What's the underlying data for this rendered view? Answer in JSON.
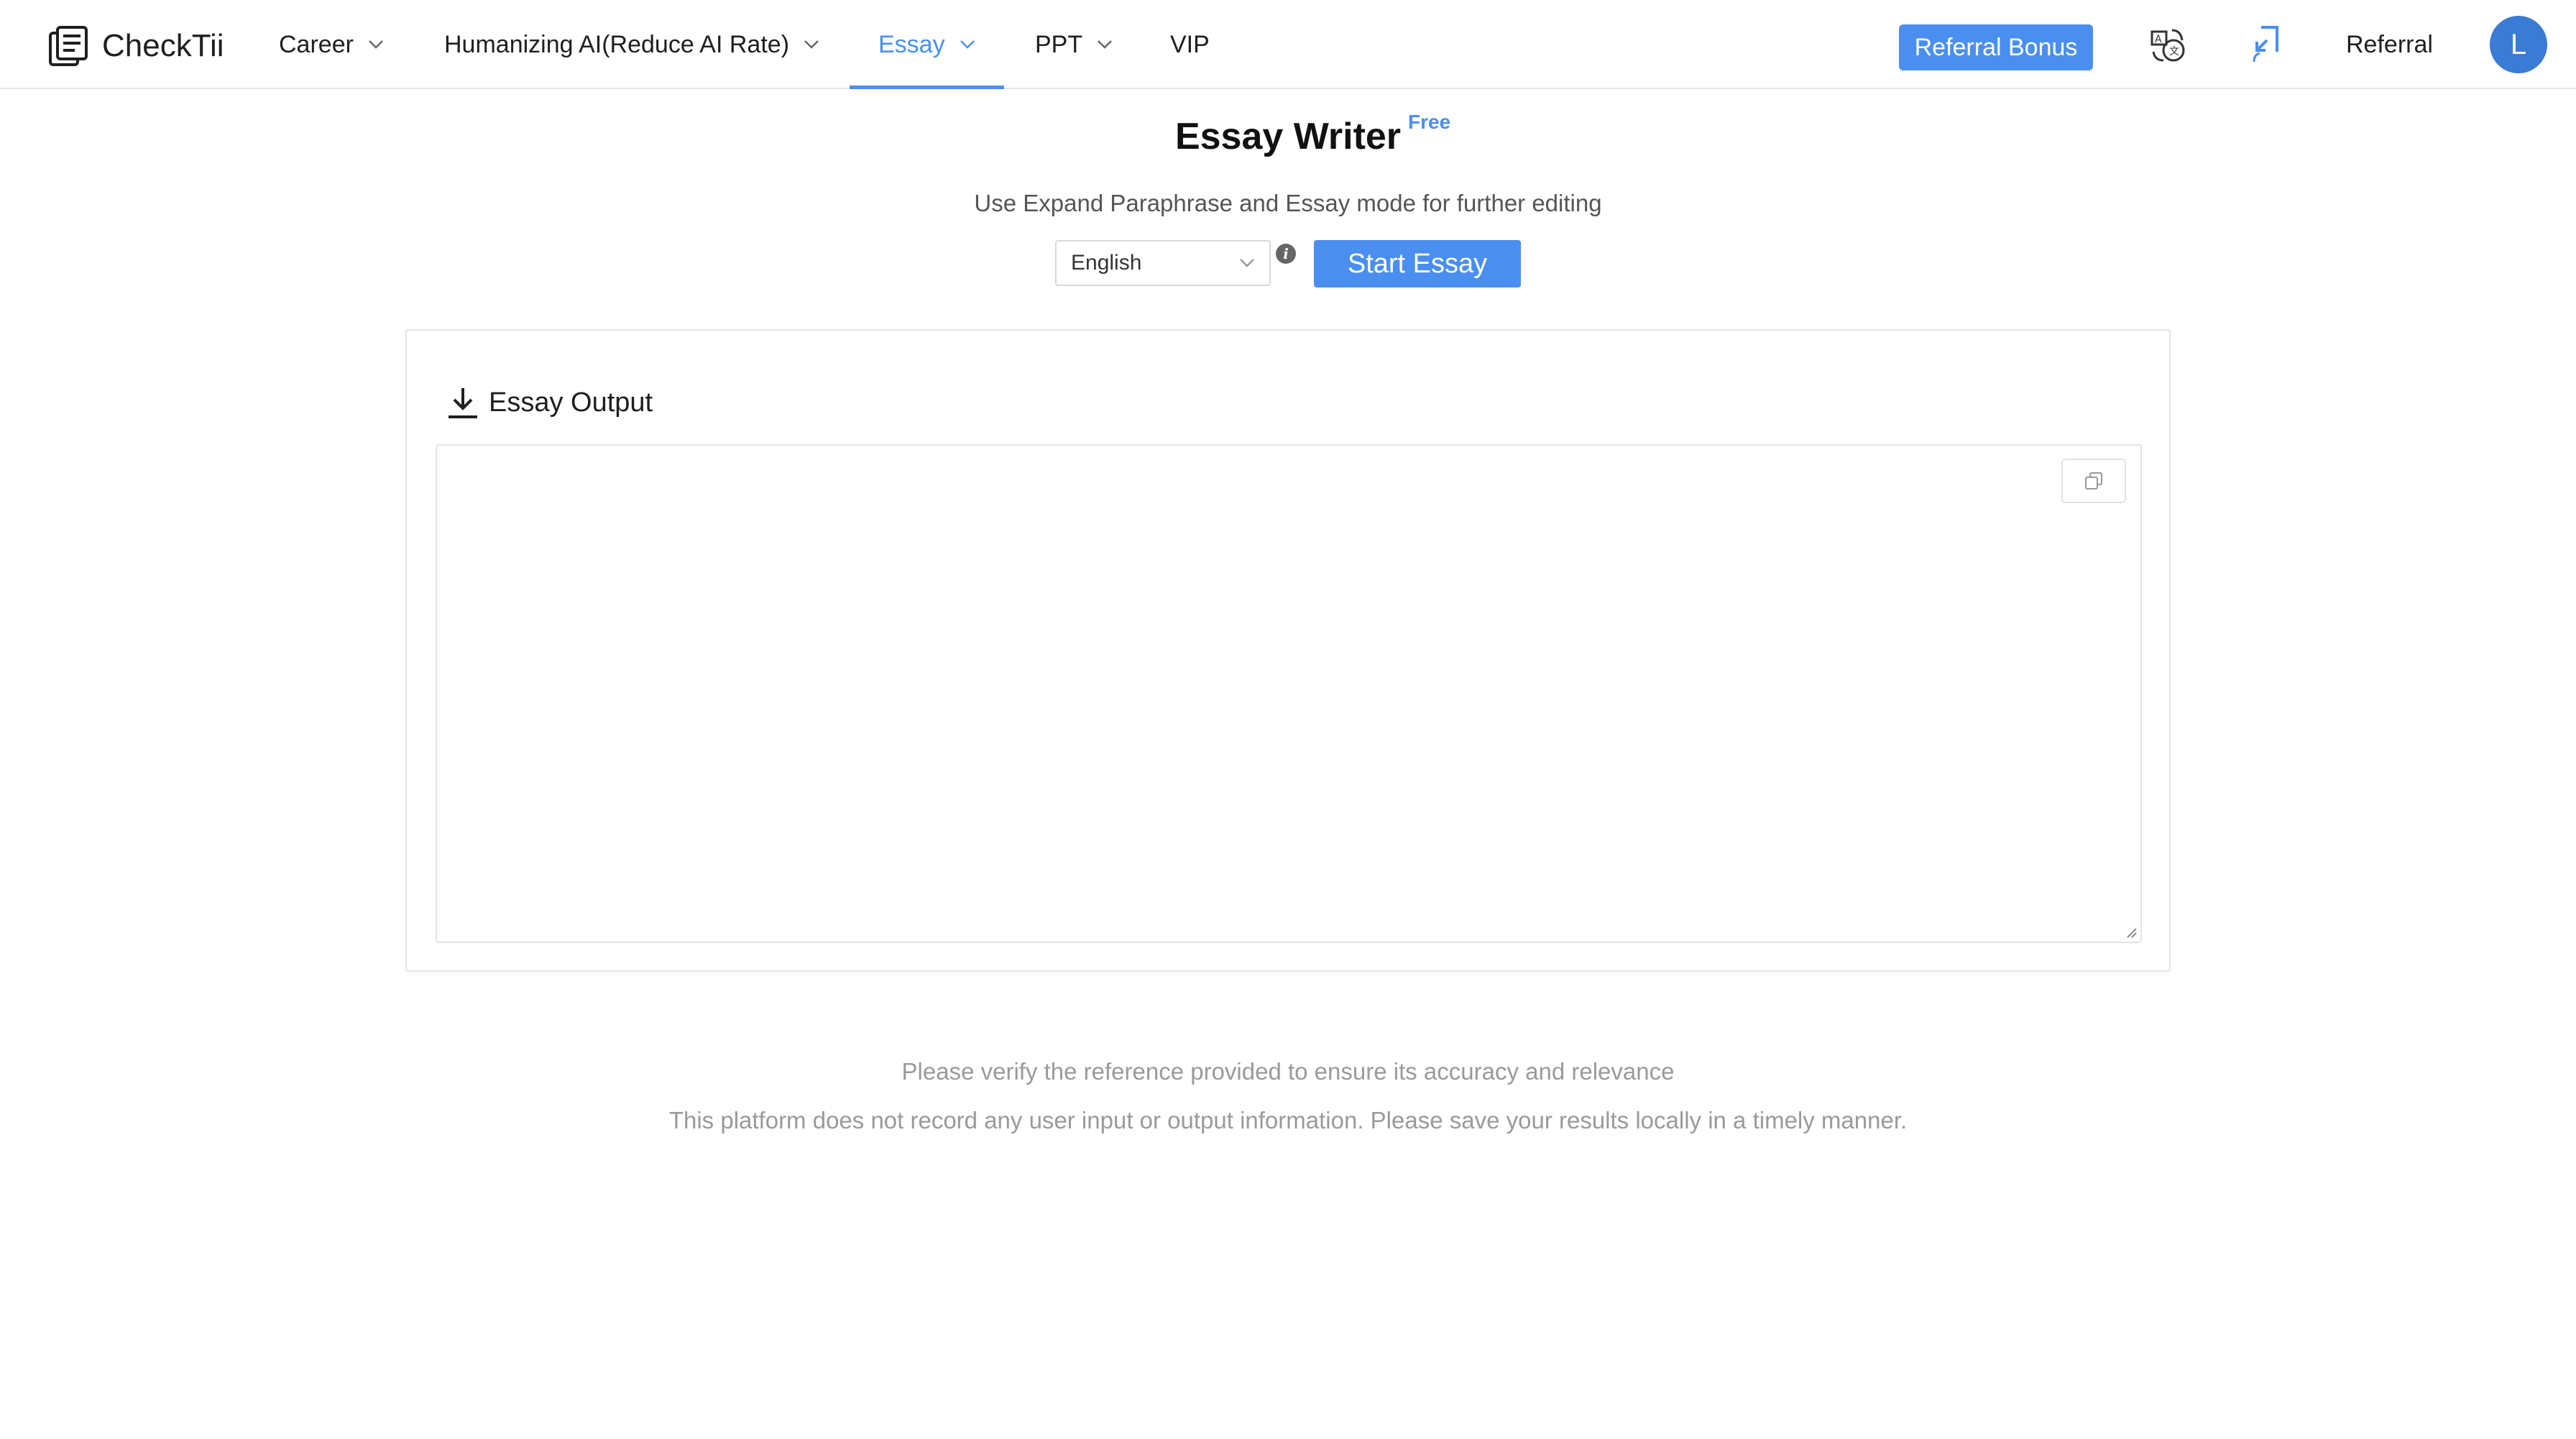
{
  "header": {
    "logo_text": "CheckTii",
    "nav": [
      {
        "label": "Career",
        "has_dropdown": true
      },
      {
        "label": "Humanizing AI(Reduce AI Rate)",
        "has_dropdown": true
      },
      {
        "label": "Essay",
        "has_dropdown": true,
        "active": true
      },
      {
        "label": "PPT",
        "has_dropdown": true
      },
      {
        "label": "VIP",
        "has_dropdown": false
      }
    ],
    "referral_bonus_label": "Referral Bonus",
    "referral_label": "Referral",
    "avatar_initial": "L",
    "icons": [
      "translate-icon",
      "share-arrow-icon"
    ]
  },
  "main": {
    "title": "Essay Writer",
    "badge": "Free",
    "subtitle": "Use Expand Paraphrase and Essay mode for further editing",
    "language": {
      "selected": "English"
    },
    "start_button": "Start Essay"
  },
  "output": {
    "title": "Essay Output",
    "content": ""
  },
  "footer": {
    "line1": "Please verify the reference provided to ensure its accuracy and relevance",
    "line2": "This platform does not record any user input or output information. Please save your results locally in a timely manner."
  },
  "colors": {
    "accent": "#4a8ff0",
    "avatar": "#3a7bd5",
    "muted_text": "#9a9a9a"
  }
}
